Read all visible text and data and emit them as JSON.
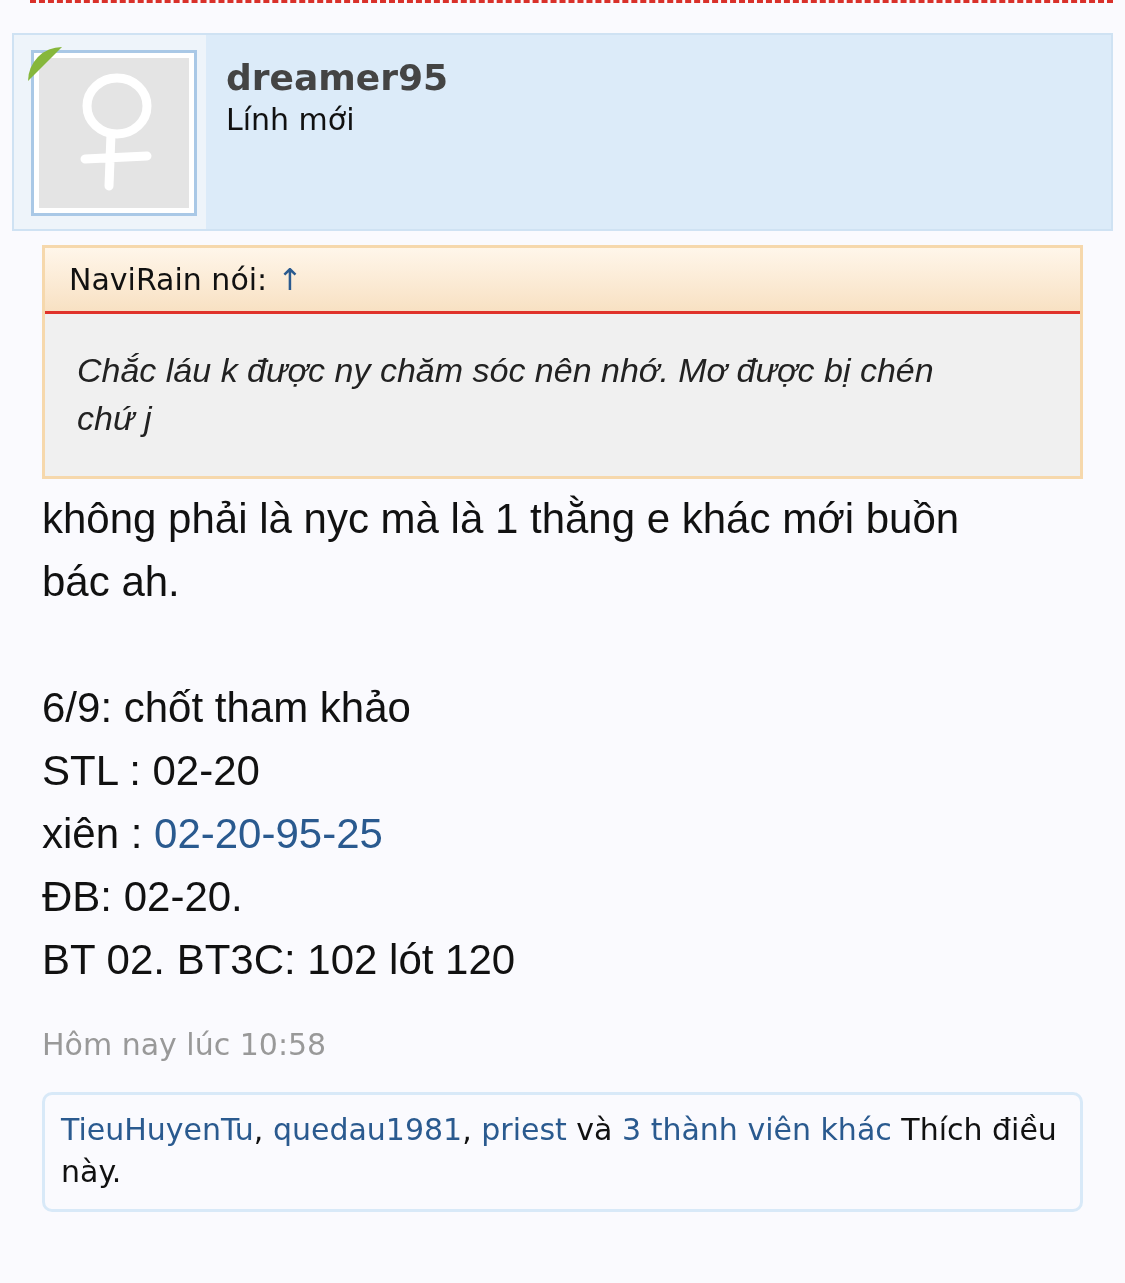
{
  "author": {
    "username": "dreamer95",
    "rank": "Lính mới",
    "online": true
  },
  "quote": {
    "author": "NaviRain nói:",
    "jump": "↑",
    "text": "Chắc láu k được ny chăm sóc nên nhớ. Mơ được bị chén chứ j"
  },
  "body": [
    {
      "lines": [
        {
          "text": "không phải là nyc mà là 1 thằng e khác mới buồn bác ah."
        }
      ]
    },
    {
      "lines": [
        {
          "text": "6/9: chốt tham khảo"
        },
        {
          "text": "STL : 02-20"
        },
        {
          "text": "xiên : ",
          "link": "02-20-95-25"
        },
        {
          "text": "ĐB: 02-20."
        },
        {
          "text": "BT 02. BT3C: 102 lót 120"
        }
      ]
    }
  ],
  "date": "Hôm nay lúc 10:58",
  "likes": [
    {
      "kind": "link",
      "text": "TieuHuyenTu"
    },
    {
      "kind": "text",
      "text": ", "
    },
    {
      "kind": "link",
      "text": "quedau1981"
    },
    {
      "kind": "text",
      "text": ", "
    },
    {
      "kind": "link",
      "text": "priest"
    },
    {
      "kind": "text",
      "text": " và "
    },
    {
      "kind": "link",
      "text": "3 thành viên khác"
    },
    {
      "kind": "text",
      "text": " Thích điều này."
    }
  ]
}
